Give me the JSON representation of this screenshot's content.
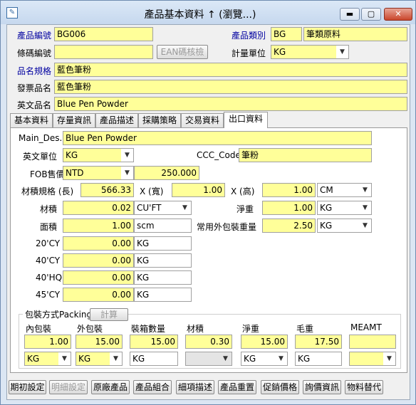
{
  "window": {
    "title": "產品基本資料 ↑ (瀏覽...)",
    "min": "▬",
    "max": "▢",
    "close": "✕"
  },
  "header": {
    "product_no_label": "產品編號",
    "product_no": "BG006",
    "category_label": "產品類別",
    "category_code": "BG",
    "category_name": "筆類原料",
    "barcode_label": "條碼編號",
    "barcode": "",
    "ean_button": "EAN碼核檢",
    "unit_label": "計量單位",
    "unit": "KG",
    "spec_label": "品名規格",
    "spec": "藍色筆粉",
    "invoice_label": "發票品名",
    "invoice": "藍色筆粉",
    "english_label": "英文品名",
    "english": "Blue Pen Powder"
  },
  "tabs": [
    "基本資料",
    "存量資訊",
    "產品描述",
    "採購策略",
    "交易資料",
    "出口資料"
  ],
  "active_tab": "出口資料",
  "export": {
    "main_des_label": "Main_Des.",
    "main_des": "Blue Pen Powder",
    "eng_unit_label": "英文單位",
    "eng_unit": "KG",
    "ccc_label": "CCC_Code",
    "ccc": "筆粉",
    "fob_label": "FOB售價",
    "fob_currency": "NTD",
    "fob_price": "250.000",
    "size_label": "材積規格 (長)",
    "length": "566.33",
    "x_wide_label": "X (寬)",
    "width": "1.00",
    "x_high_label": "X (高)",
    "height": "1.00",
    "size_unit": "CM",
    "volume_label": "材積",
    "volume": "0.02",
    "volume_unit": "CU'FT",
    "net_label": "淨重",
    "net": "1.00",
    "net_unit": "KG",
    "area_label": "面積",
    "area": "1.00",
    "area_unit": "scm",
    "outer_label": "常用外包裝重量",
    "outer": "2.50",
    "outer_unit": "KG",
    "cy20_label": "20'CY",
    "cy20": "0.00",
    "cy20_unit": "KG",
    "cy40_label": "40'CY",
    "cy40": "0.00",
    "cy40_unit": "KG",
    "hq40_label": "40'HQ",
    "hq40": "0.00",
    "hq40_unit": "KG",
    "cy45_label": "45'CY",
    "cy45": "0.00",
    "cy45_unit": "KG"
  },
  "packing": {
    "title": "包裝方式Packing",
    "calc_button": "計算",
    "inner_label": "內包裝",
    "inner": "1.00",
    "inner_unit": "KG",
    "outer_label": "外包裝",
    "outer": "15.00",
    "outer_unit": "KG",
    "box_qty_label": "裝箱數量",
    "box_qty": "15.00",
    "box_unit": "KG",
    "volume_label": "材積",
    "volume": "0.30",
    "net_label": "淨重",
    "net": "15.00",
    "net_unit": "KG",
    "gross_label": "毛重",
    "gross": "17.50",
    "gross_unit": "KG",
    "meamt_label": "MEAMT",
    "meamt": ""
  },
  "bottom_buttons": [
    "期初設定",
    "明細設定",
    "原廠產品",
    "產品組合",
    "細項描述",
    "產品重置",
    "促銷價格",
    "詢價資訊",
    "物料替代"
  ]
}
